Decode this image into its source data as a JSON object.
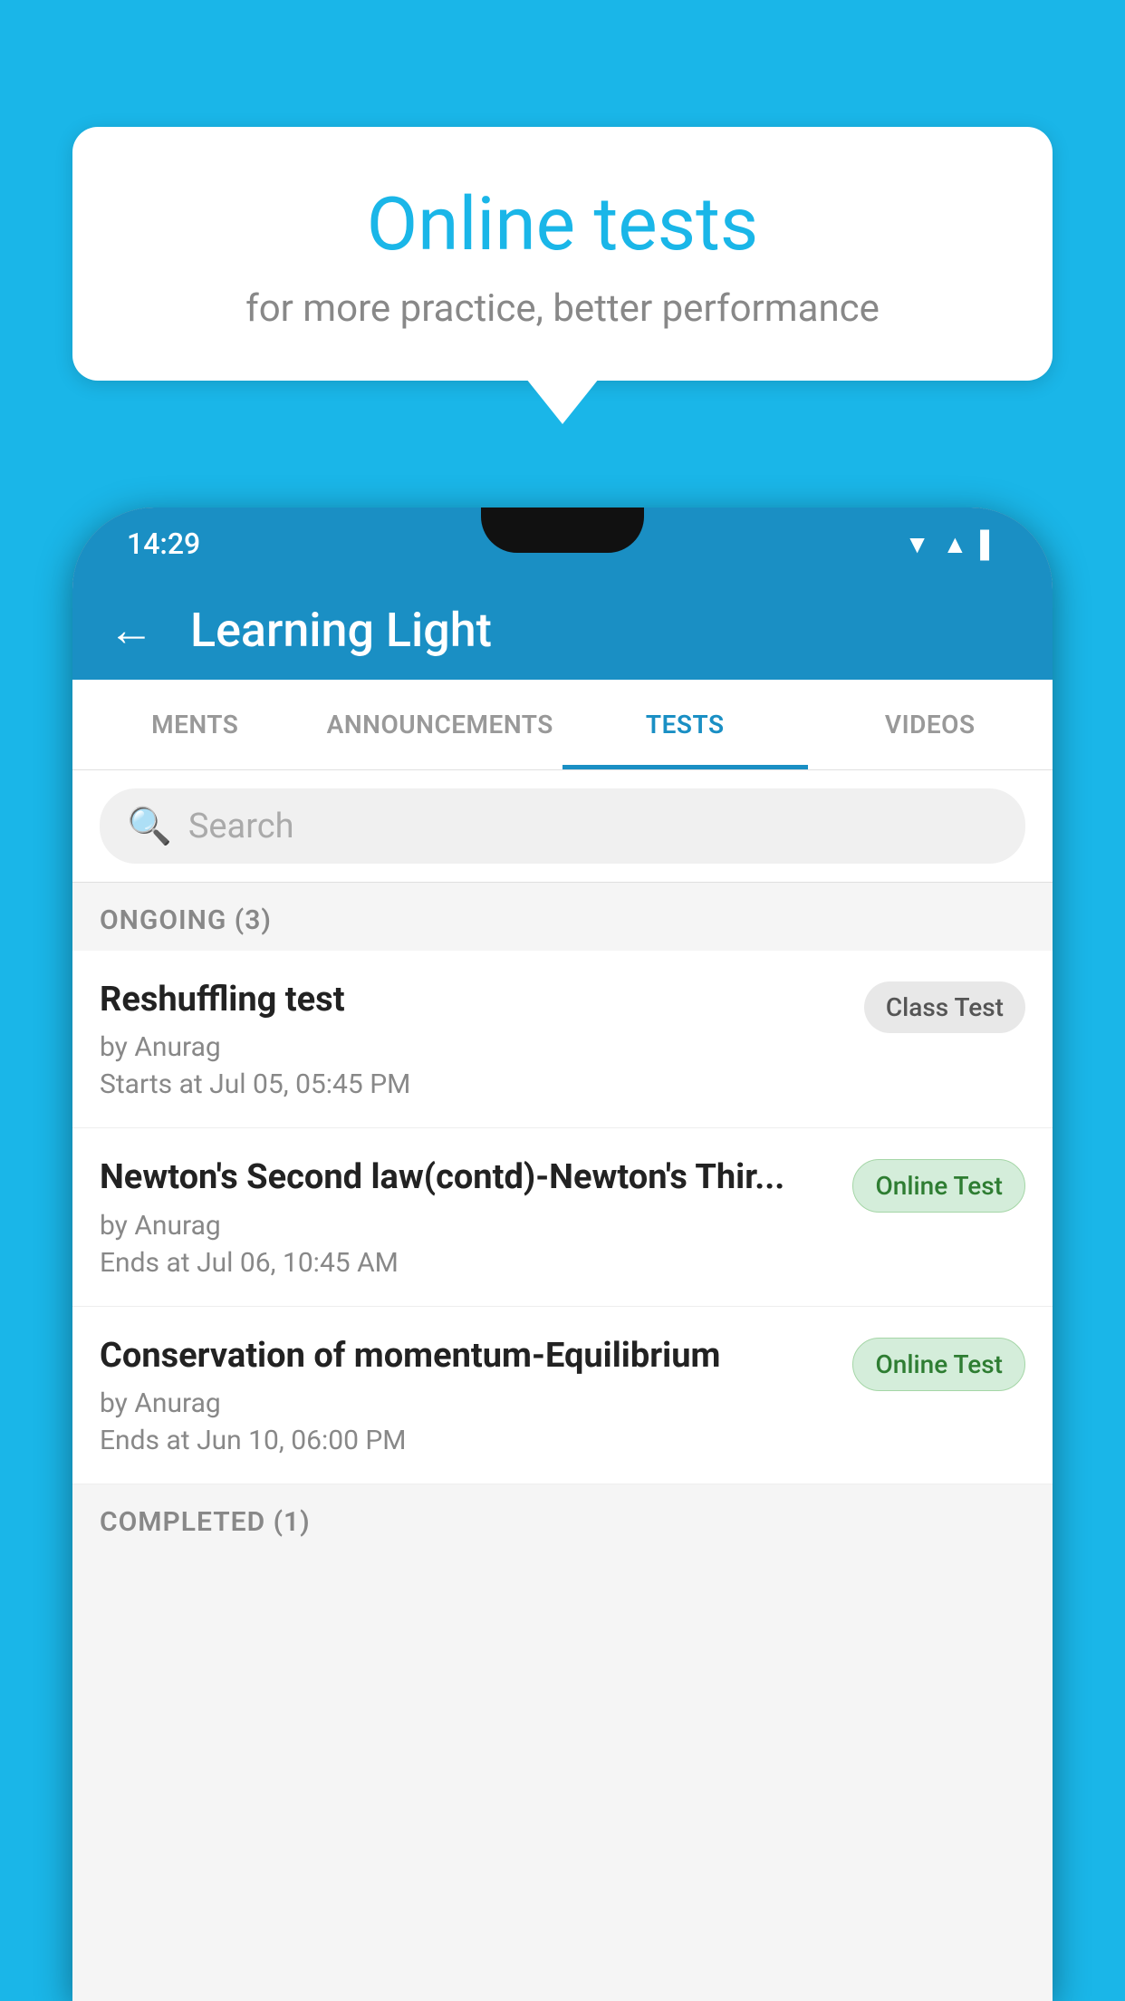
{
  "background_color": "#1ab6e8",
  "speech_bubble": {
    "title": "Online tests",
    "subtitle": "for more practice, better performance"
  },
  "phone": {
    "status_bar": {
      "time": "14:29",
      "icons": [
        "wifi",
        "signal",
        "battery"
      ]
    },
    "app_header": {
      "title": "Learning Light",
      "back_label": "←"
    },
    "tabs": [
      {
        "label": "MENTS",
        "active": false
      },
      {
        "label": "ANNOUNCEMENTS",
        "active": false
      },
      {
        "label": "TESTS",
        "active": true
      },
      {
        "label": "VIDEOS",
        "active": false
      }
    ],
    "search": {
      "placeholder": "Search"
    },
    "ongoing_section": {
      "label": "ONGOING (3)"
    },
    "tests": [
      {
        "name": "Reshuffling test",
        "by": "by Anurag",
        "time_label": "Starts at",
        "time": "Jul 05, 05:45 PM",
        "badge": "Class Test",
        "badge_type": "class"
      },
      {
        "name": "Newton's Second law(contd)-Newton's Thir...",
        "by": "by Anurag",
        "time_label": "Ends at",
        "time": "Jul 06, 10:45 AM",
        "badge": "Online Test",
        "badge_type": "online"
      },
      {
        "name": "Conservation of momentum-Equilibrium",
        "by": "by Anurag",
        "time_label": "Ends at",
        "time": "Jun 10, 06:00 PM",
        "badge": "Online Test",
        "badge_type": "online"
      }
    ],
    "completed_section": {
      "label": "COMPLETED (1)"
    }
  }
}
